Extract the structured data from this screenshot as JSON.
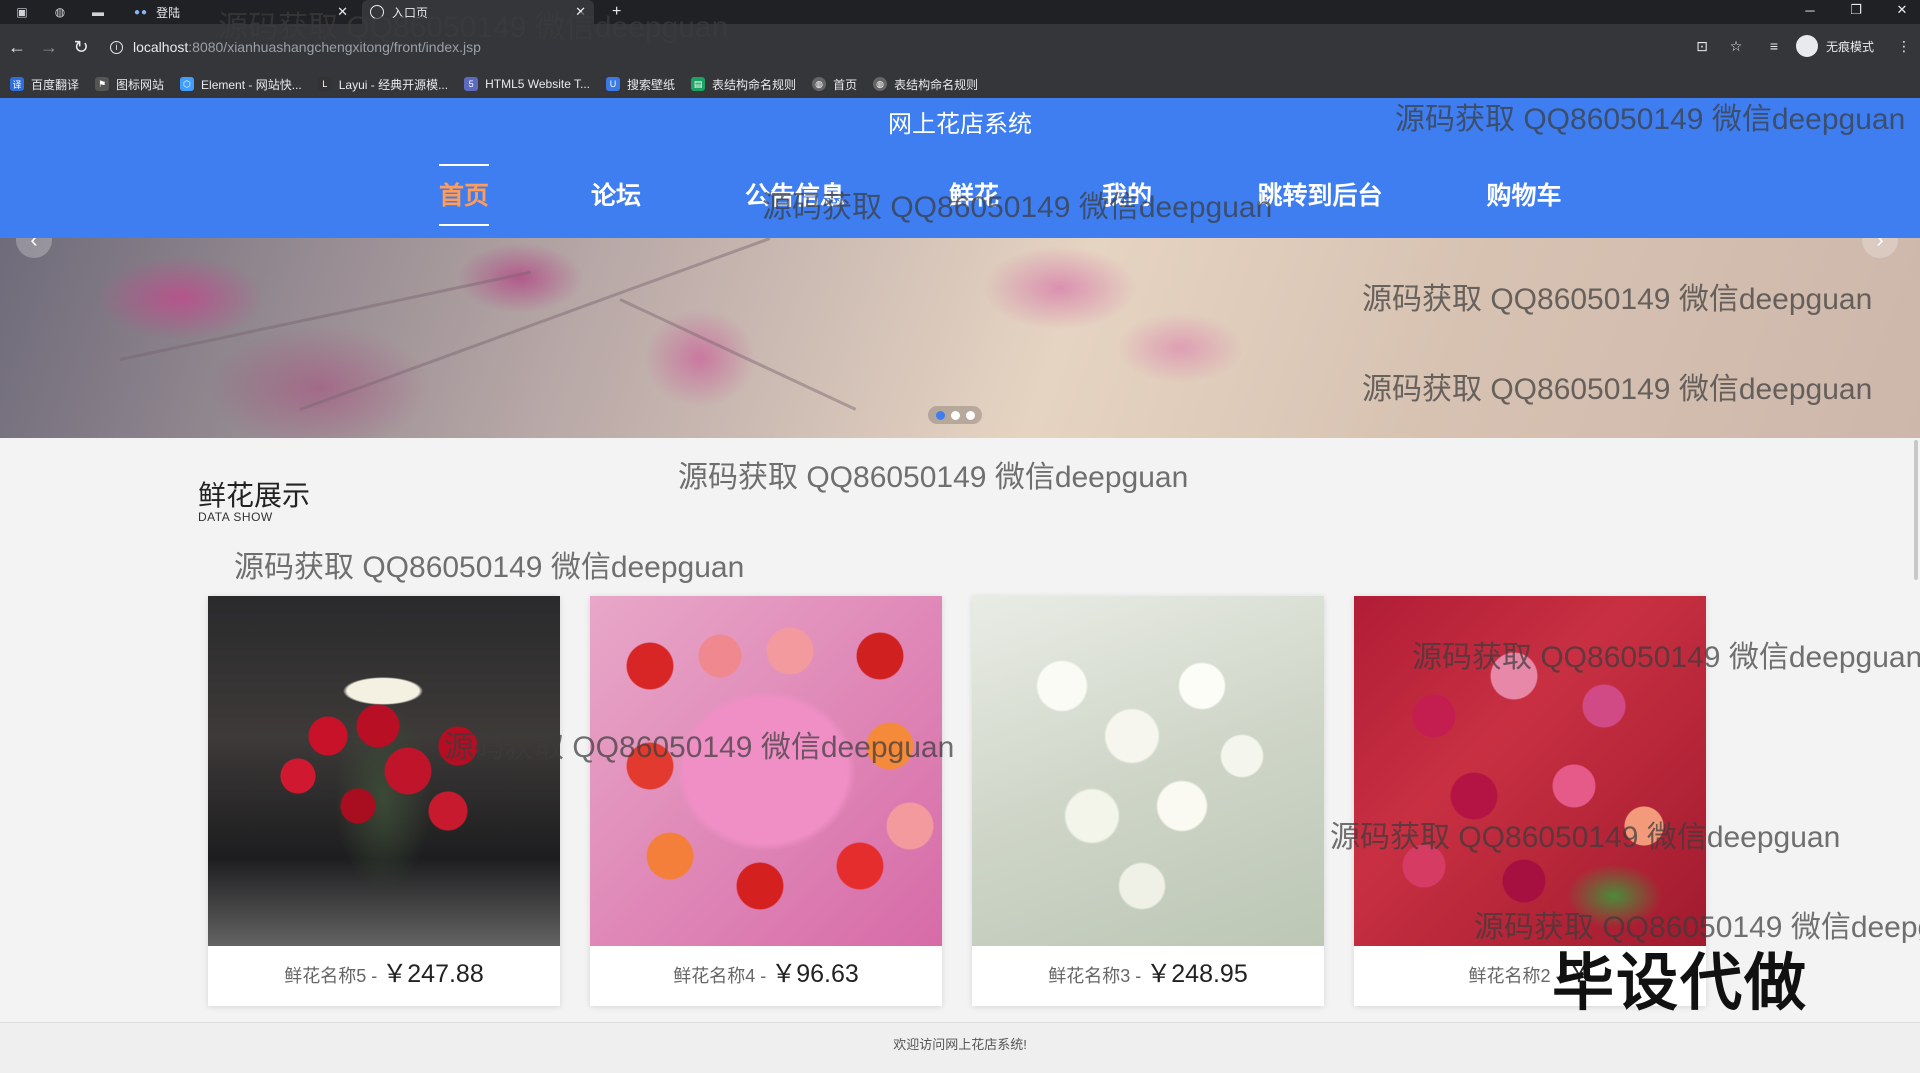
{
  "browser": {
    "tabs": [
      {
        "label": "登陆",
        "active": false
      },
      {
        "label": "入口页",
        "active": true
      }
    ],
    "new_tab": "+",
    "url_host": "localhost",
    "url_path": ":8080/xianhuashangchengxitong/front/index.jsp",
    "profile_label": "无痕模式",
    "bookmarks": [
      {
        "label": "百度翻译",
        "icon": "translate-icon",
        "color": "#2f6fdc"
      },
      {
        "label": "图标网站",
        "icon": "flag-icon",
        "color": "#555555"
      },
      {
        "label": "Element - 网站快...",
        "icon": "element-icon",
        "color": "#409eff"
      },
      {
        "label": "Layui - 经典开源模...",
        "icon": "layui-icon",
        "color": "#333333"
      },
      {
        "label": "HTML5 Website T...",
        "icon": "html5-icon",
        "color": "#5c6bc0"
      },
      {
        "label": "搜索壁纸",
        "icon": "wallpaper-icon",
        "color": "#3b79e5"
      },
      {
        "label": "表结构命名规则",
        "icon": "sheet-icon",
        "color": "#19a463"
      },
      {
        "label": "首页",
        "icon": "globe-icon",
        "color": "#666666"
      },
      {
        "label": "表结构命名规则",
        "icon": "globe-icon",
        "color": "#666666"
      }
    ]
  },
  "site": {
    "title": "网上花店系统",
    "accent": "#3f7ef1",
    "active_color": "#ff9c5a",
    "menu": [
      {
        "label": "首页",
        "active": true
      },
      {
        "label": "论坛"
      },
      {
        "label": "公告信息"
      },
      {
        "label": "鲜花"
      },
      {
        "label": "我的"
      },
      {
        "label": "跳转到后台"
      },
      {
        "label": "购物车"
      }
    ],
    "carousel": {
      "slides": 3,
      "active": 1
    }
  },
  "section": {
    "title": "鲜花展示",
    "subtitle": "DATA SHOW"
  },
  "products": [
    {
      "name": "鲜花名称5",
      "sep": " - ",
      "price": "￥247.88"
    },
    {
      "name": "鲜花名称4",
      "sep": " - ",
      "price": "￥96.63"
    },
    {
      "name": "鲜花名称3",
      "sep": " - ",
      "price": "￥248.95"
    },
    {
      "name": "鲜花名称2",
      "sep": " - ",
      "price": "￥"
    }
  ],
  "footer": {
    "text": "欢迎访问网上花店系统!"
  },
  "watermark": {
    "text": "源码获取 QQ86050149 微信deepguan",
    "stamp": "毕设代做"
  }
}
